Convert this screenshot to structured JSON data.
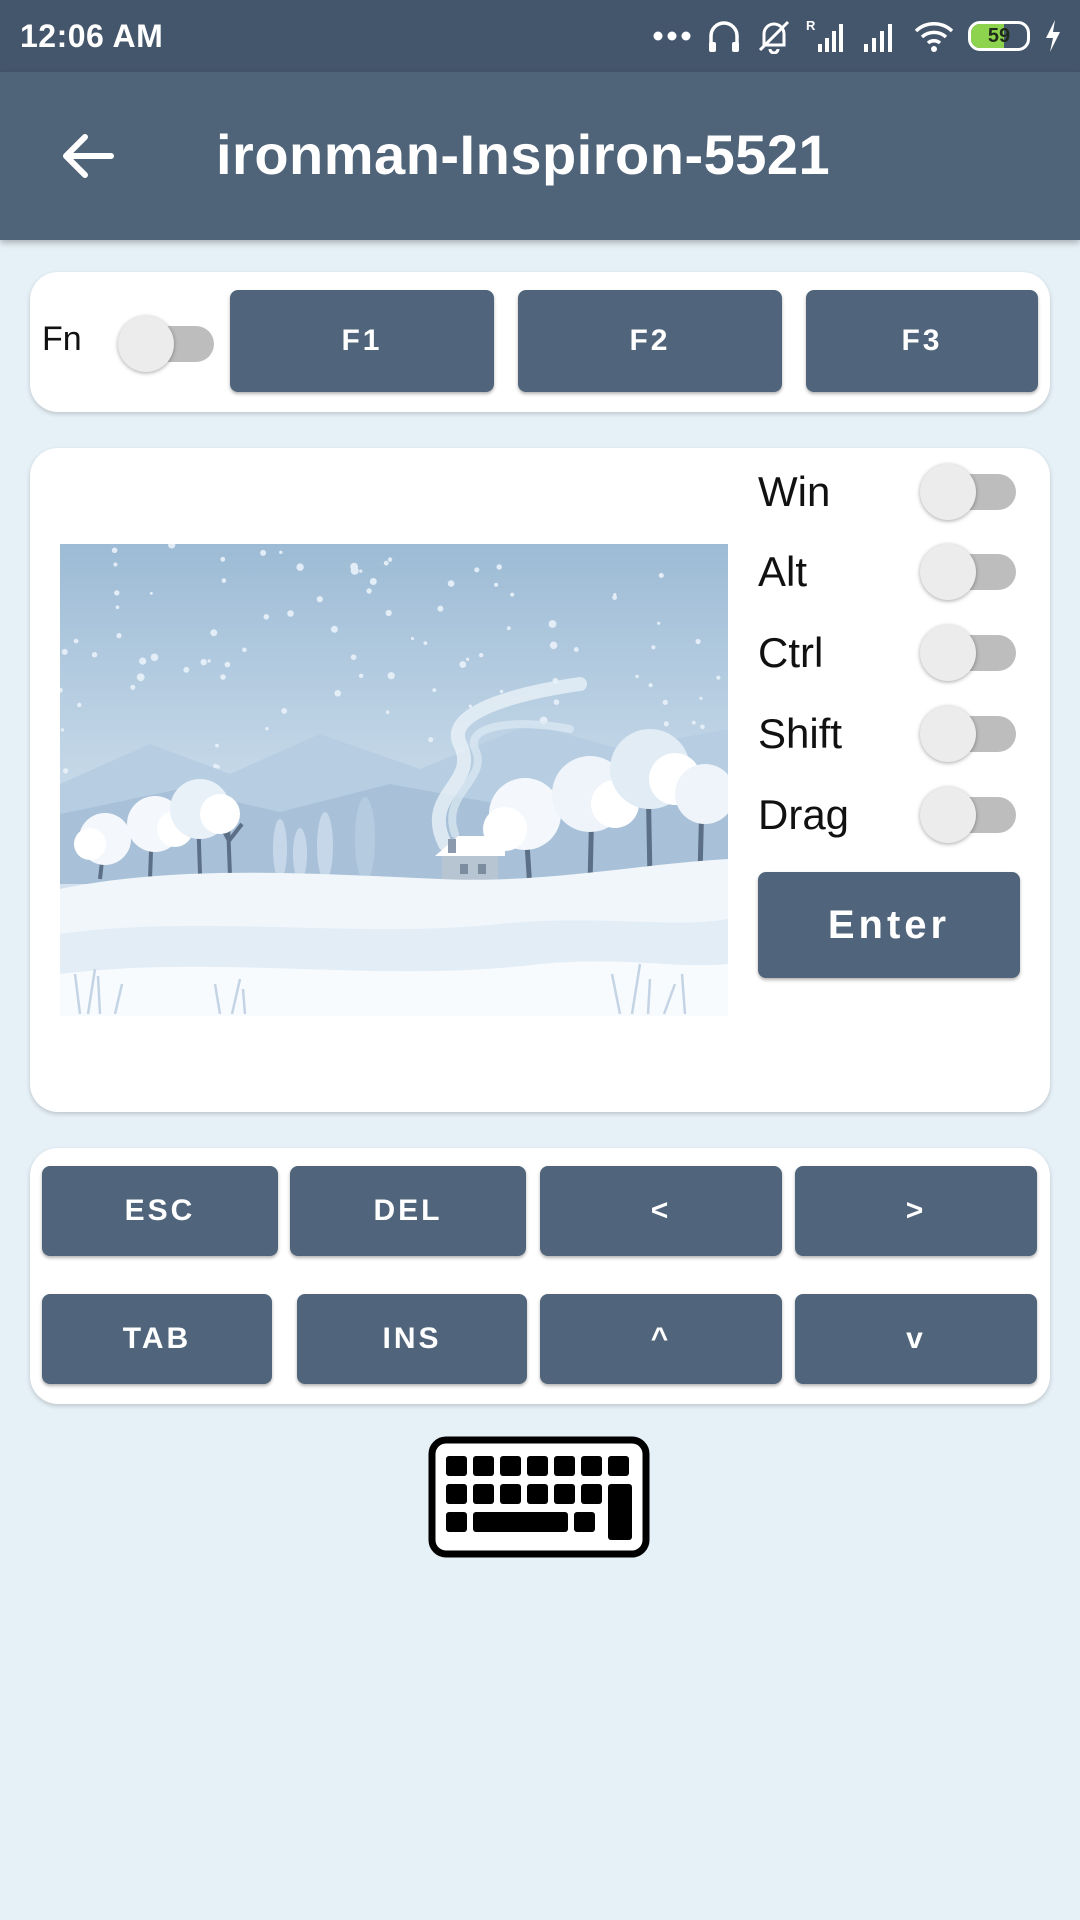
{
  "status_bar": {
    "time": "12:06 AM",
    "battery_level": 59,
    "battery_text": "59",
    "icons": [
      "more-dots-icon",
      "headphones-icon",
      "muted-bell-icon",
      "roaming-signal-icon",
      "signal-icon",
      "wifi-icon",
      "battery-icon",
      "charging-icon"
    ]
  },
  "app_bar": {
    "title": "ironman-Inspiron-5521",
    "back_icon": "arrow-left-icon"
  },
  "function_row": {
    "fn_label": "Fn",
    "fn_on": false,
    "keys": [
      "F1",
      "F2",
      "F3"
    ]
  },
  "modifiers": [
    {
      "label": "Win",
      "on": false
    },
    {
      "label": "Alt",
      "on": false
    },
    {
      "label": "Ctrl",
      "on": false
    },
    {
      "label": "Shift",
      "on": false
    },
    {
      "label": "Drag",
      "on": false
    }
  ],
  "enter_label": "Enter",
  "touchpad_image": "winter-landscape",
  "nav_keys": {
    "row1": [
      "ESC",
      "DEL",
      "<",
      ">"
    ],
    "row2": [
      "TAB",
      "INS",
      "^",
      "v"
    ]
  },
  "keyboard_icon": "keyboard-icon",
  "colors": {
    "status_bar": "#44566b",
    "app_bar": "#4f6379",
    "background": "#e6f0f7",
    "key": "#50657b",
    "battery_fill": "#8ed34e"
  }
}
